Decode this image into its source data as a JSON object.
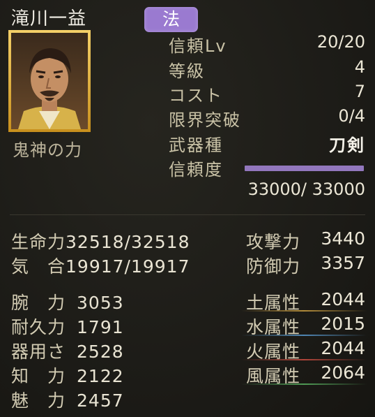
{
  "header": {
    "name": "滝川一益",
    "badge": "法"
  },
  "skill": "鬼神の力",
  "info": [
    {
      "label": "信頼Lv",
      "value": "20/20"
    },
    {
      "label": "等級",
      "value": "4"
    },
    {
      "label": "コスト",
      "value": "7"
    },
    {
      "label": "限界突破",
      "value": "0/4"
    },
    {
      "label": "武器種",
      "value": "刀剣"
    },
    {
      "label": "信頼度",
      "value": ""
    }
  ],
  "trust": {
    "value": "33000/ 33000",
    "fraction": 1.0,
    "color": "#9277bd"
  },
  "stats_left_top": [
    {
      "label": "生命力",
      "value": "32518/32518"
    },
    {
      "label": "気　合",
      "value": "19917/19917"
    }
  ],
  "stats_right_top": [
    {
      "label": "攻撃力",
      "value": "3440"
    },
    {
      "label": "防御力",
      "value": "3357"
    }
  ],
  "stats_left": [
    {
      "label": "腕　力",
      "value": "3053"
    },
    {
      "label": "耐久力",
      "value": "1791"
    },
    {
      "label": "器用さ",
      "value": "2528"
    },
    {
      "label": "知　力",
      "value": "2122"
    },
    {
      "label": "魅　力",
      "value": "2457"
    }
  ],
  "elements": [
    {
      "label": "土属性",
      "value": "2044",
      "color": "#b08a3a"
    },
    {
      "label": "水属性",
      "value": "2015",
      "color": "#4f86b3"
    },
    {
      "label": "火属性",
      "value": "2044",
      "color": "#b0453a"
    },
    {
      "label": "風属性",
      "value": "2064",
      "color": "#4f9a55"
    }
  ],
  "portrait_icon": "character-portrait"
}
